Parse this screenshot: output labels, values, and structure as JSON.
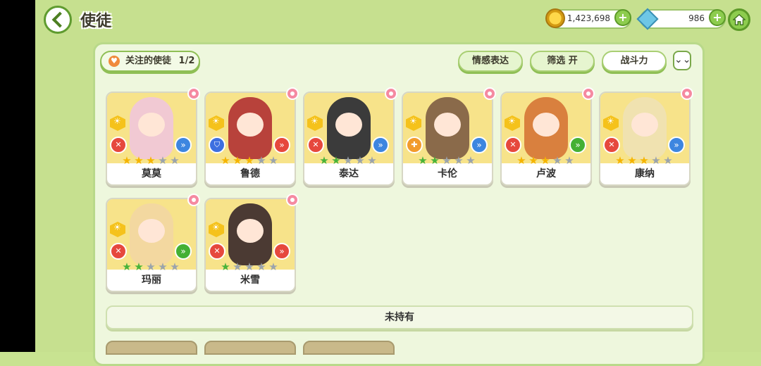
{
  "header": {
    "title": "使徒"
  },
  "currency": {
    "gold": "1,423,698",
    "gems": "986",
    "plus": "+"
  },
  "filters": {
    "follow_label": "关注的使徒",
    "follow_count": "1/2",
    "emotion": "情感表达",
    "filter": "筛选 开",
    "power": "战斗力",
    "expand": "⌄⌄"
  },
  "characters": [
    {
      "name": "莫莫",
      "stars": 3,
      "star_color": "gold",
      "role": "✕",
      "role_color": "#e6483d",
      "elem": "»",
      "elem_color": "#3d86e0",
      "char_color": "#f1c9d3"
    },
    {
      "name": "鲁德",
      "stars": 3,
      "star_color": "gold",
      "role": "⛉",
      "role_color": "#3d6fe0",
      "elem": "»",
      "elem_color": "#e6483d",
      "char_color": "#b8423b"
    },
    {
      "name": "泰达",
      "stars": 2,
      "star_color": "green",
      "role": "✕",
      "role_color": "#e6483d",
      "elem": "»",
      "elem_color": "#3d86e0",
      "char_color": "#3b3b3b"
    },
    {
      "name": "卡伦",
      "stars": 2,
      "star_color": "green",
      "role": "✚",
      "role_color": "#f29b2c",
      "elem": "»",
      "elem_color": "#3d86e0",
      "char_color": "#8a6a4a"
    },
    {
      "name": "卢波",
      "stars": 3,
      "star_color": "gold",
      "role": "✕",
      "role_color": "#e6483d",
      "elem": "»",
      "elem_color": "#44b034",
      "char_color": "#d9803e"
    },
    {
      "name": "康纳",
      "stars": 3,
      "star_color": "gold",
      "role": "✕",
      "role_color": "#e6483d",
      "elem": "»",
      "elem_color": "#3d86e0",
      "char_color": "#f0e2b0"
    },
    {
      "name": "玛丽",
      "stars": 2,
      "star_color": "green",
      "role": "✕",
      "role_color": "#e6483d",
      "elem": "»",
      "elem_color": "#44b034",
      "char_color": "#f3d8a0"
    },
    {
      "name": "米雪",
      "stars": 1,
      "star_color": "green",
      "role": "✕",
      "role_color": "#e6483d",
      "elem": "»",
      "elem_color": "#e6483d",
      "char_color": "#4b3a33"
    }
  ],
  "not_owned_label": "未持有"
}
